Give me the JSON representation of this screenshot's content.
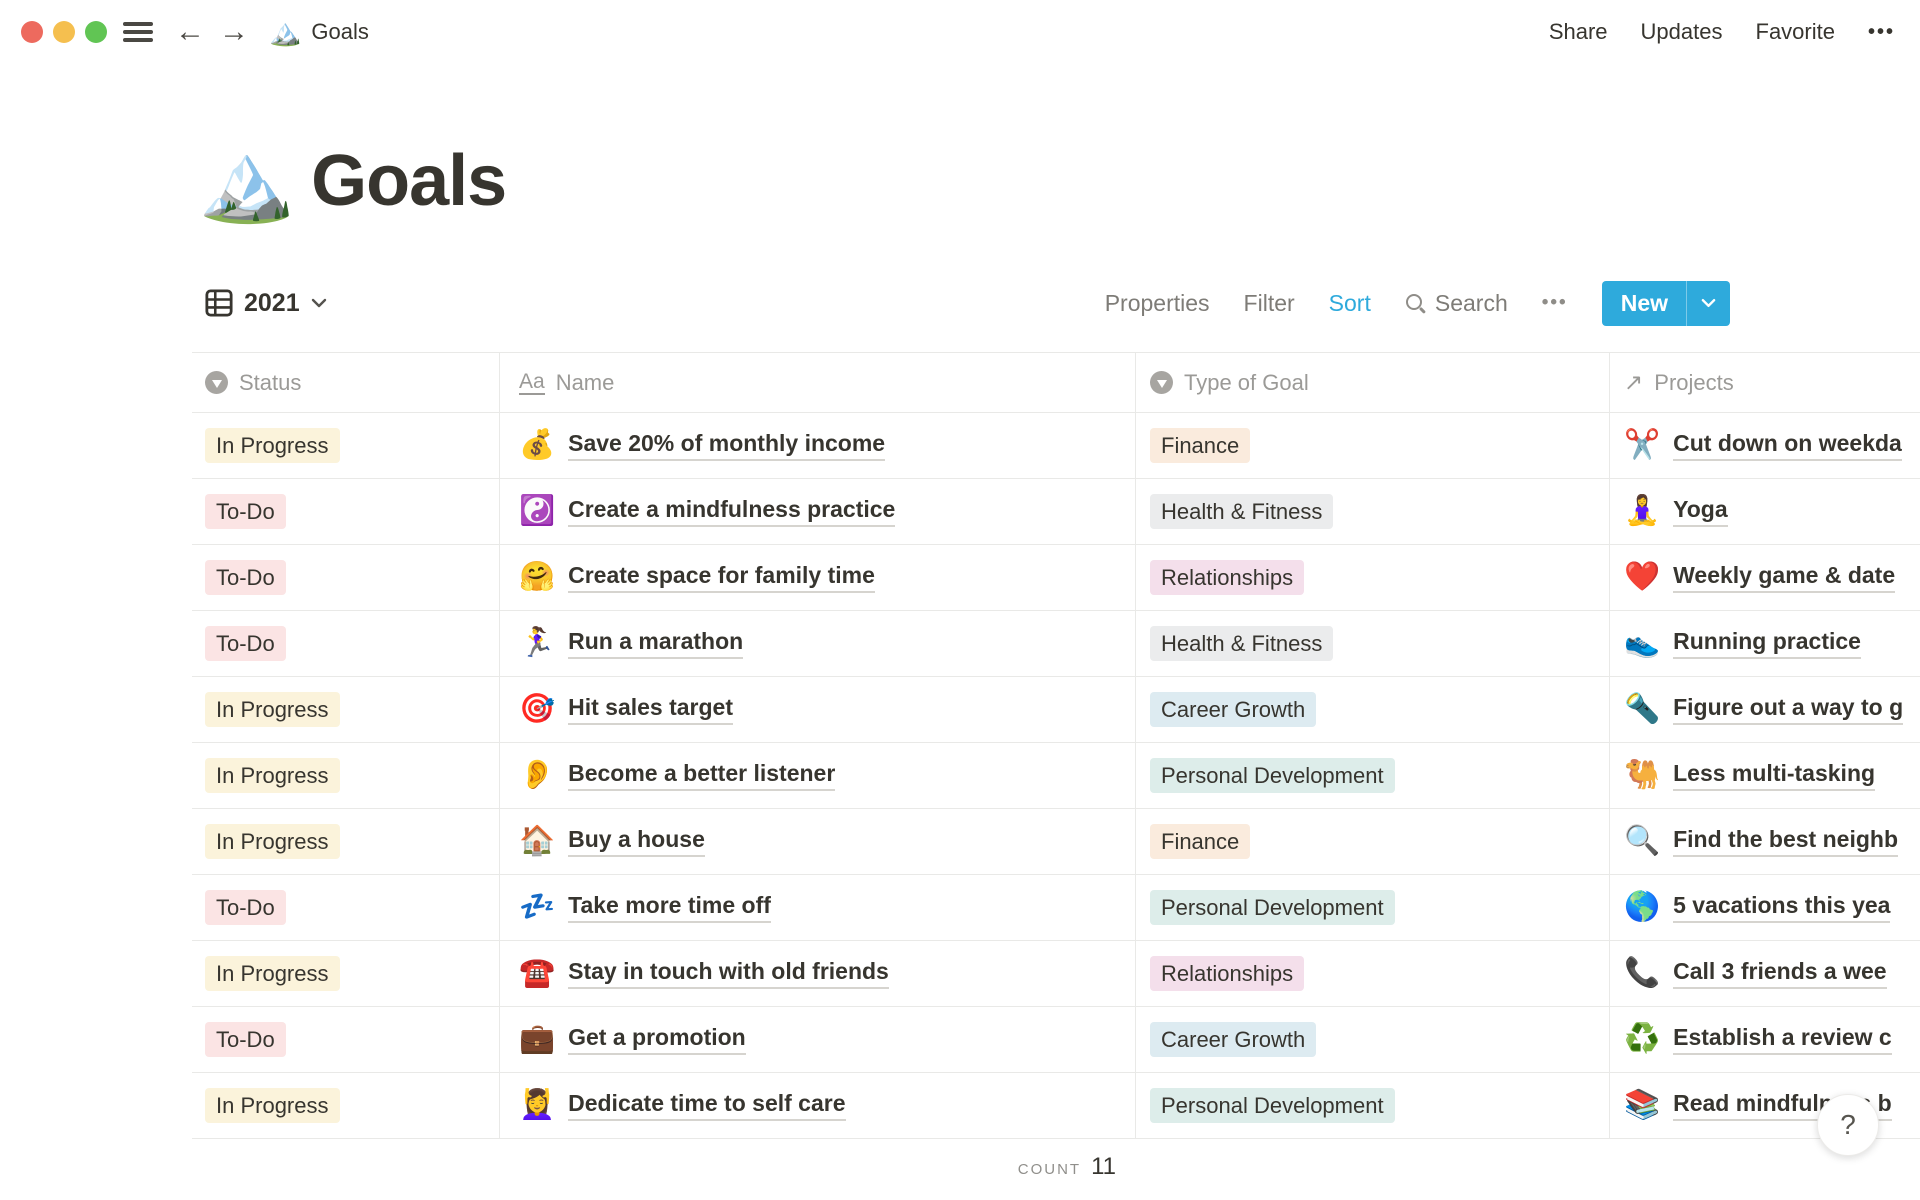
{
  "window": {
    "breadcrumb": {
      "icon": "🏔️",
      "title": "Goals"
    },
    "actions": {
      "share": "Share",
      "updates": "Updates",
      "favorite": "Favorite",
      "more": "•••"
    }
  },
  "page": {
    "icon": "🏔️",
    "title": "Goals"
  },
  "toolbar": {
    "view_label": "2021",
    "properties": "Properties",
    "filter": "Filter",
    "sort": "Sort",
    "search": "Search",
    "more": "•••",
    "new_label": "New"
  },
  "table": {
    "columns": [
      {
        "label": "Status",
        "icon": "select"
      },
      {
        "label": "Name",
        "icon": "Aa"
      },
      {
        "label": "Type of Goal",
        "icon": "select"
      },
      {
        "label": "Projects",
        "icon": "↗"
      }
    ],
    "rows": [
      {
        "status": {
          "label": "In Progress",
          "color": "yellow"
        },
        "name": {
          "emoji": "💰",
          "text": "Save 20% of monthly income"
        },
        "type": {
          "label": "Finance",
          "color": "orange"
        },
        "project": {
          "emoji": "✂️",
          "text": "Cut down on weekda"
        }
      },
      {
        "status": {
          "label": "To-Do",
          "color": "red"
        },
        "name": {
          "emoji": "☯️",
          "text": "Create a mindfulness practice"
        },
        "type": {
          "label": "Health & Fitness",
          "color": "gray"
        },
        "project": {
          "emoji": "🧘‍♀️",
          "text": "Yoga"
        }
      },
      {
        "status": {
          "label": "To-Do",
          "color": "red"
        },
        "name": {
          "emoji": "🤗",
          "text": "Create space for family time"
        },
        "type": {
          "label": "Relationships",
          "color": "pink"
        },
        "project": {
          "emoji": "❤️",
          "text": "Weekly game & date"
        }
      },
      {
        "status": {
          "label": "To-Do",
          "color": "red"
        },
        "name": {
          "emoji": "🏃‍♀️",
          "text": "Run a marathon"
        },
        "type": {
          "label": "Health & Fitness",
          "color": "gray"
        },
        "project": {
          "emoji": "👟",
          "text": "Running practice"
        }
      },
      {
        "status": {
          "label": "In Progress",
          "color": "yellow"
        },
        "name": {
          "emoji": "🎯",
          "text": "Hit sales target"
        },
        "type": {
          "label": "Career Growth",
          "color": "blue"
        },
        "project": {
          "emoji": "🔦",
          "text": "Figure out a way to g"
        }
      },
      {
        "status": {
          "label": "In Progress",
          "color": "yellow"
        },
        "name": {
          "emoji": "👂",
          "text": "Become a better listener"
        },
        "type": {
          "label": "Personal Development",
          "color": "green"
        },
        "project": {
          "emoji": "🐫",
          "text": "Less multi-tasking"
        }
      },
      {
        "status": {
          "label": "In Progress",
          "color": "yellow"
        },
        "name": {
          "emoji": "🏠",
          "text": "Buy a house"
        },
        "type": {
          "label": "Finance",
          "color": "orange"
        },
        "project": {
          "emoji": "🔍",
          "text": "Find the best neighb"
        }
      },
      {
        "status": {
          "label": "To-Do",
          "color": "red"
        },
        "name": {
          "emoji": "💤",
          "text": "Take more time off"
        },
        "type": {
          "label": "Personal Development",
          "color": "green"
        },
        "project": {
          "emoji": "🌎",
          "text": "5 vacations this yea"
        }
      },
      {
        "status": {
          "label": "In Progress",
          "color": "yellow"
        },
        "name": {
          "emoji": "☎️",
          "text": "Stay in touch with old friends"
        },
        "type": {
          "label": "Relationships",
          "color": "pink"
        },
        "project": {
          "emoji": "📞",
          "text": "Call 3 friends a wee"
        }
      },
      {
        "status": {
          "label": "To-Do",
          "color": "red"
        },
        "name": {
          "emoji": "💼",
          "text": "Get a promotion"
        },
        "type": {
          "label": "Career Growth",
          "color": "blue"
        },
        "project": {
          "emoji": "♻️",
          "text": "Establish a review c"
        }
      },
      {
        "status": {
          "label": "In Progress",
          "color": "yellow"
        },
        "name": {
          "emoji": "💆‍♀️",
          "text": "Dedicate time to self care"
        },
        "type": {
          "label": "Personal Development",
          "color": "green"
        },
        "project": {
          "emoji": "📚",
          "text": "Read mindfulness b"
        }
      }
    ],
    "count_label": "COUNT",
    "count_value": "11"
  },
  "help": {
    "label": "?"
  },
  "colors": {
    "accent": "#2EAADC",
    "traffic": {
      "red": "#ED6A5E",
      "yellow": "#F5BF4F",
      "green": "#61C554"
    },
    "badges": {
      "yellow": "#FBF3DB",
      "red": "#FBE4E4",
      "orange": "#FAEBDD",
      "gray": "#EBECED",
      "pink": "#F4DFEB",
      "blue": "#DDEBF1",
      "green": "#DDEDEA"
    }
  }
}
